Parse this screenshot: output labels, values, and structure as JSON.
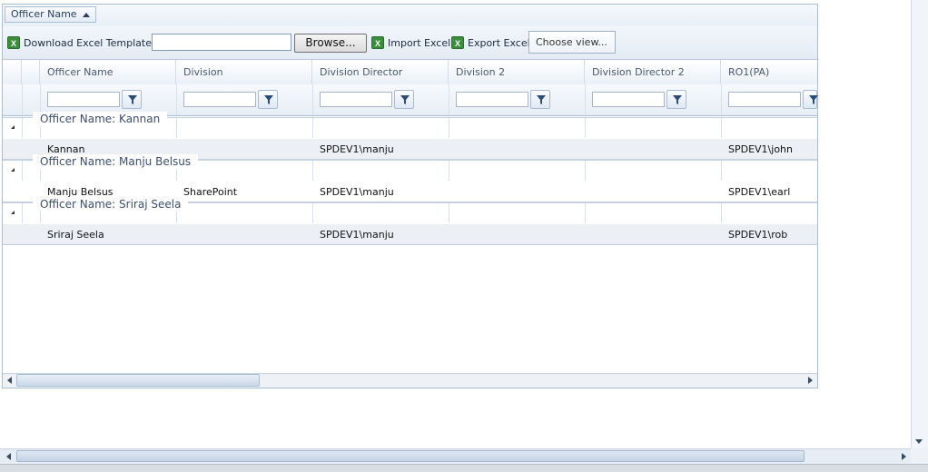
{
  "grouping": {
    "chip_label": "Officer Name"
  },
  "toolbar": {
    "download_label": "Download Excel Template",
    "file_value": "",
    "browse_label": "Browse...",
    "import_label": "Import Excel",
    "export_label": "Export Excel",
    "choose_view_label": "Choose view..."
  },
  "columns": [
    "Officer Name",
    "Division",
    "Division Director",
    "Division 2",
    "Division Director 2",
    "RO1(PA)"
  ],
  "groups": [
    {
      "label": "Officer Name: Kannan",
      "row": {
        "officer": "Kannan",
        "division": "",
        "director": "SPDEV1\\manju",
        "division2": "",
        "director2": "",
        "ro1": "SPDEV1\\john"
      }
    },
    {
      "label": "Officer Name: Manju Belsus",
      "row": {
        "officer": "Manju Belsus",
        "division": "SharePoint",
        "director": "SPDEV1\\manju",
        "division2": "",
        "director2": "",
        "ro1": "SPDEV1\\earl"
      }
    },
    {
      "label": "Officer Name: Sriraj Seela",
      "row": {
        "officer": "Sriraj Seela",
        "division": "",
        "director": "SPDEV1\\manju",
        "division2": "",
        "director2": "",
        "ro1": "SPDEV1\\rob"
      }
    }
  ],
  "colors": {
    "accent": "#a9bfd6",
    "row_bg": "#eceff4",
    "excel_icon": "#3c8d3c"
  }
}
